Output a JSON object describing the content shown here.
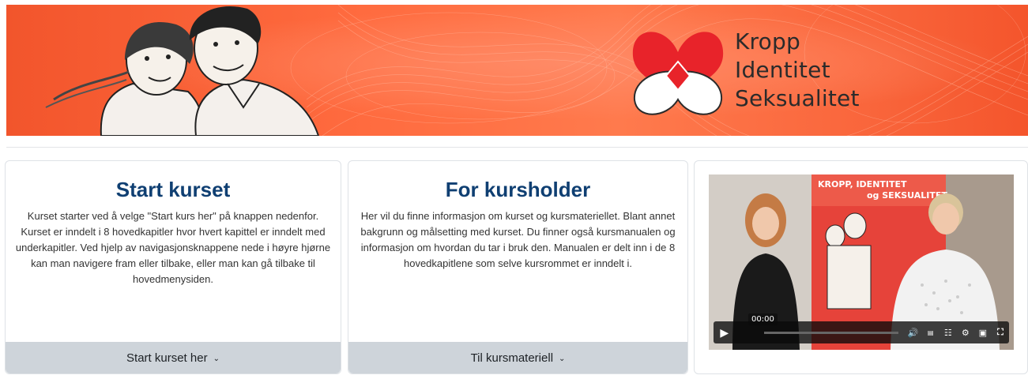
{
  "banner": {
    "brand_lines": [
      "Kropp",
      "Identitet",
      "Seksualitet"
    ],
    "colors": {
      "background": "#f25a2f",
      "logo_red": "#e8232a",
      "text": "#2b2b2b"
    }
  },
  "cards": [
    {
      "title": "Start kurset",
      "body": "Kurset starter ved å velge \"Start kurs her\" på knappen nedenfor. Kurset er inndelt i 8 hovedkapitler hvor hvert kapittel er inndelt med underkapitler. Ved hjelp av navigasjonsknappene nede i høyre hjørne kan man navigere fram eller tilbake, eller man kan gå tilbake til hovedmenysiden.",
      "button_label": "Start kurset her",
      "button_icon": "chevron-down-icon"
    },
    {
      "title": "For kursholder",
      "body": "Her vil du finne informasjon om kurset og kursmateriellet. Blant annet bakgrunn og målsetting med kurset. Du finner også kursmanualen og informasjon om hvordan du tar i bruk den. Manualen er delt inn i de 8 hovedkapitlene som selve kursrommet er inndelt i.",
      "button_label": "Til kursmateriell",
      "button_icon": "chevron-down-icon"
    }
  ],
  "video": {
    "poster_text_line1": "KROPP, IDENTITET",
    "poster_text_line2": "og SEKSUALITET",
    "time_tooltip": "00:00",
    "progress": 0,
    "controls": [
      "play-icon",
      "volume-icon",
      "captions-icon",
      "transcript-icon",
      "settings-icon",
      "pip-icon",
      "fullscreen-icon"
    ]
  }
}
